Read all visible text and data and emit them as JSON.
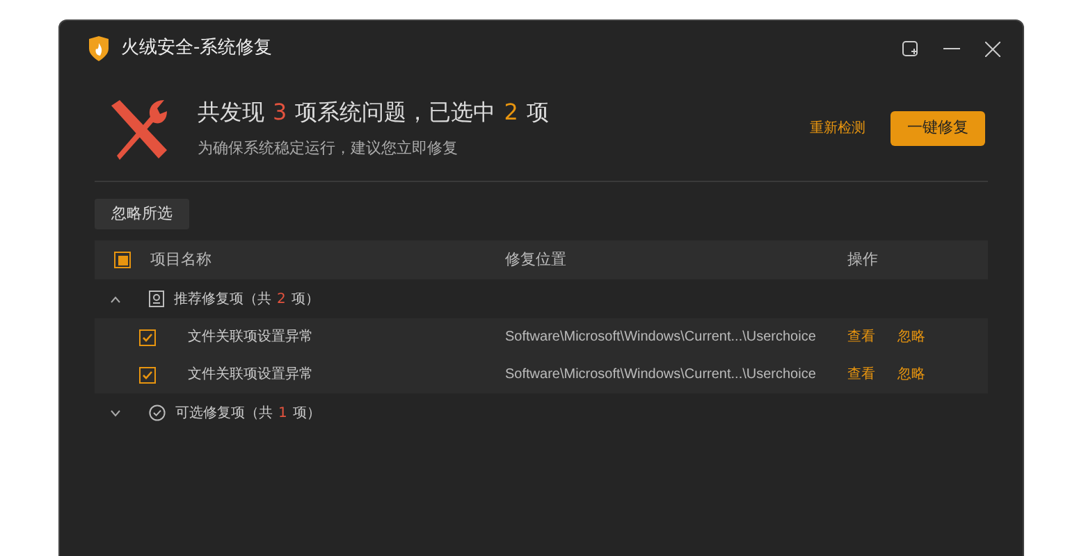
{
  "window": {
    "title": "火绒安全-系统修复"
  },
  "summary": {
    "prefix": "共发现",
    "found": "3",
    "middle": "项系统问题，已选中",
    "selected": "2",
    "suffix": "项",
    "subtitle": "为确保系统稳定运行，建议您立即修复"
  },
  "actions": {
    "rescan": "重新检测",
    "fix_all": "一键修复"
  },
  "ignore_button": "忽略所选",
  "table": {
    "select_all": {
      "mixed": true
    },
    "columns": [
      "项目名称",
      "修复位置",
      "操作"
    ],
    "groups": [
      {
        "label": "推荐修复项（共",
        "count": "2",
        "suffix": "项）",
        "expanded": true,
        "kind": "recommended",
        "items": [
          {
            "name": "文件关联项设置异常",
            "location": "Software\\Microsoft\\Windows\\Current...\\Userchoice",
            "checked": true,
            "actions": [
              "查看",
              "忽略"
            ]
          },
          {
            "name": "文件关联项设置异常",
            "location": "Software\\Microsoft\\Windows\\Current...\\Userchoice",
            "checked": true,
            "actions": [
              "查看",
              "忽略"
            ]
          }
        ]
      },
      {
        "label": "可选修复项（共",
        "count": "1",
        "suffix": "项）",
        "expanded": false,
        "kind": "optional"
      }
    ]
  }
}
